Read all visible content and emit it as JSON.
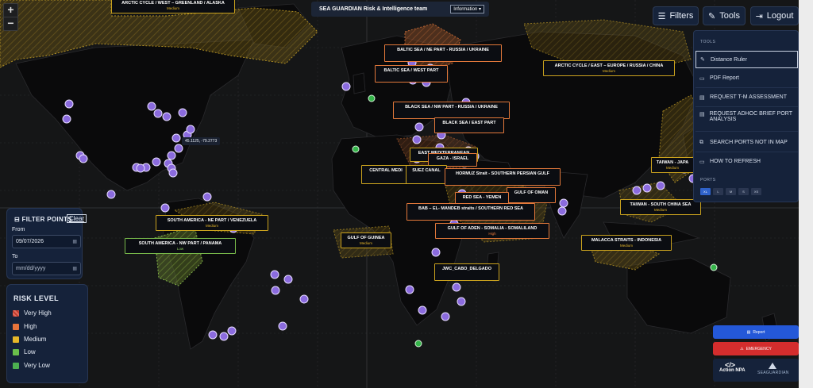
{
  "titlebar": {
    "title": "SEA GUARDIAN Risk & Intelligence team",
    "mode": "Information"
  },
  "zoom": {
    "in": "+",
    "out": "−"
  },
  "top_buttons": {
    "filters": "Filters",
    "tools": "Tools",
    "logout": "Logout"
  },
  "tools_menu": {
    "header": "TOOLS",
    "items": [
      "Distance Ruler",
      "PDF Report",
      "REQUEST T-M ASSESSMENT",
      "REQUEST ADHOC BRIEF PORT ANALYSIS",
      "SEARCH PORTS NOT IN MAP",
      "HOW TO REFRESH"
    ],
    "ports_label": "PORTS",
    "sizes": [
      "XL",
      "L",
      "M",
      "S",
      "XS"
    ]
  },
  "coord_tooltip": "45.1125, -79.2773",
  "filter_points": {
    "title": "FILTER POINTS",
    "clear": "Clear",
    "from_label": "From",
    "from_value": "09/07/2026",
    "to_label": "To",
    "to_placeholder": "mm/dd/yyyy"
  },
  "risk_level": {
    "title": "RISK LEVEL",
    "items": [
      {
        "label": "Very High",
        "color": "#c0392b"
      },
      {
        "label": "High",
        "color": "#e8743b"
      },
      {
        "label": "Medium",
        "color": "#e6b729"
      },
      {
        "label": "Low",
        "color": "#6abf4b"
      },
      {
        "label": "Very Low",
        "color": "#4caf50"
      }
    ]
  },
  "actions": {
    "report": "Report",
    "emergency": "EMERGENCY"
  },
  "brand": {
    "name": "Action NPA",
    "code": "</>",
    "product": "SEAGUARDIAN"
  },
  "areas": [
    {
      "name": "ARCTIC CYCLE / WEST – GREENLAND / ALASKA",
      "level": "Medium"
    },
    {
      "name": "BALTIC SEA / NE PART - RUSSIA / UKRAINE",
      "level": ""
    },
    {
      "name": "BALTIC SEA / WEST PART",
      "level": ""
    },
    {
      "name": "ARCTIC CYCLE / EAST – EUROPE / RUSSIA / CHINA",
      "level": "Medium"
    },
    {
      "name": "BLACK SEA / NW PART - RUSSIA / UKRAINE",
      "level": ""
    },
    {
      "name": "BLACK SEA / EAST PART",
      "level": ""
    },
    {
      "name": "EAST MEDITERRANEAN",
      "level": ""
    },
    {
      "name": "GAZA - ISRAEL",
      "level": ""
    },
    {
      "name": "CENTRAL MEDI",
      "level": ""
    },
    {
      "name": "SUEZ CANAL",
      "level": ""
    },
    {
      "name": "HORMUZ Strait - SOUTHERN PERSIAN GULF",
      "level": ""
    },
    {
      "name": "GULF OF OMAN",
      "level": ""
    },
    {
      "name": "RED SEA - YEMEN",
      "level": ""
    },
    {
      "name": "BAB – EL- MANDEB straits / SOUTHERN RED SEA",
      "level": ""
    },
    {
      "name": "GULF OF ADEN - SOMALIA - SOMALILAND",
      "level": "High"
    },
    {
      "name": "TAIWAN - JAPA",
      "level": "Medium"
    },
    {
      "name": "TAIWAN - SOUTH CHINA SEA",
      "level": "Medium"
    },
    {
      "name": "MALACCA STRAITS - INDONESIA",
      "level": "Medium"
    },
    {
      "name": "SOUTH AMERICA - NE PART / VENEZUELA",
      "level": "Medium"
    },
    {
      "name": "SOUTH AMERICA - NW PART / PANAMA",
      "level": "Low"
    },
    {
      "name": "GULF OF GUINEA",
      "level": "Medium"
    },
    {
      "name": "JWC_CABO_DELGADO",
      "level": ""
    }
  ]
}
